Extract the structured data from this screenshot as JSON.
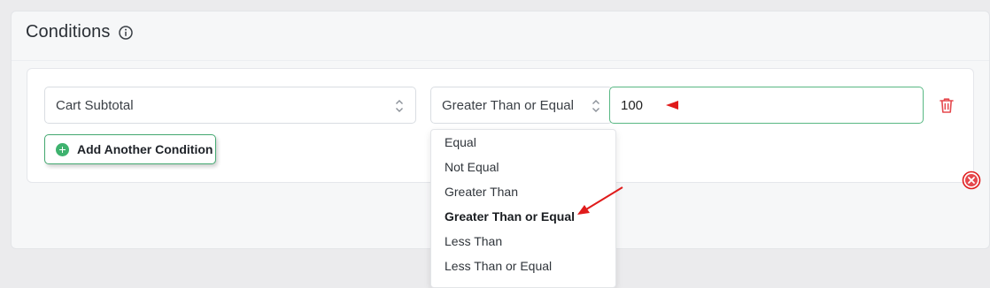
{
  "panel": {
    "title": "Conditions",
    "info_icon": "info-circle-icon"
  },
  "condition": {
    "field_value": "Cart Subtotal",
    "operator_value": "Greater Than or Equal",
    "input_value": "100",
    "delete_icon": "trash-icon"
  },
  "add_button": {
    "label": "Add Another Condition",
    "icon": "plus-circle-icon"
  },
  "operator_options": [
    {
      "label": "Equal"
    },
    {
      "label": "Not Equal"
    },
    {
      "label": "Greater Than"
    },
    {
      "label": "Greater Than or Equal",
      "selected": true
    },
    {
      "label": "Less Than"
    },
    {
      "label": "Less Than or Equal"
    }
  ],
  "colors": {
    "accent_green": "#43a870",
    "delete_red": "#e5484d",
    "annotation_red": "#e01b1b"
  }
}
